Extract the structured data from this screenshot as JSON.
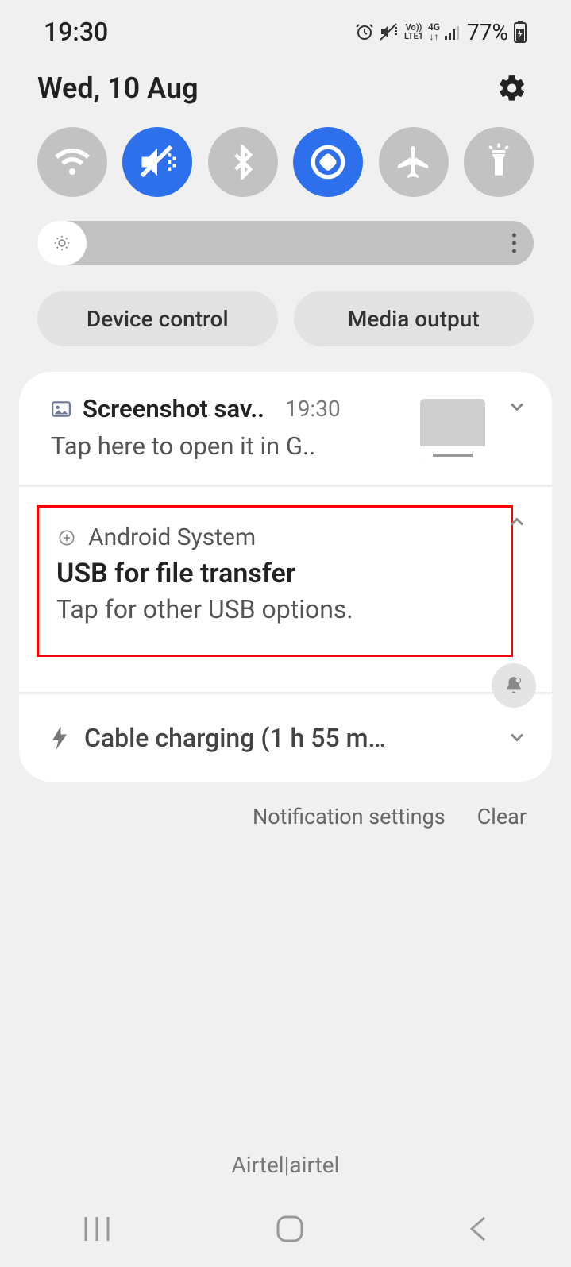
{
  "status": {
    "time": "19:30",
    "battery_pct": "77%",
    "volte_label": "Vo))",
    "lte_label": "LTE1",
    "net_label": "4G"
  },
  "header": {
    "date": "Wed, 10 Aug"
  },
  "chips": {
    "device_control": "Device control",
    "media_output": "Media output"
  },
  "notifications": {
    "screenshot": {
      "title": "Screenshot sav..",
      "time": "19:30",
      "body": "Tap here to open it in G.."
    },
    "usb": {
      "app": "Android System",
      "title": "USB for file transfer",
      "body": "Tap for other USB options."
    },
    "charging": {
      "title": "Cable charging (1 h 55 m…"
    }
  },
  "footer": {
    "settings": "Notification settings",
    "clear": "Clear"
  },
  "carrier": "Airtel|airtel"
}
